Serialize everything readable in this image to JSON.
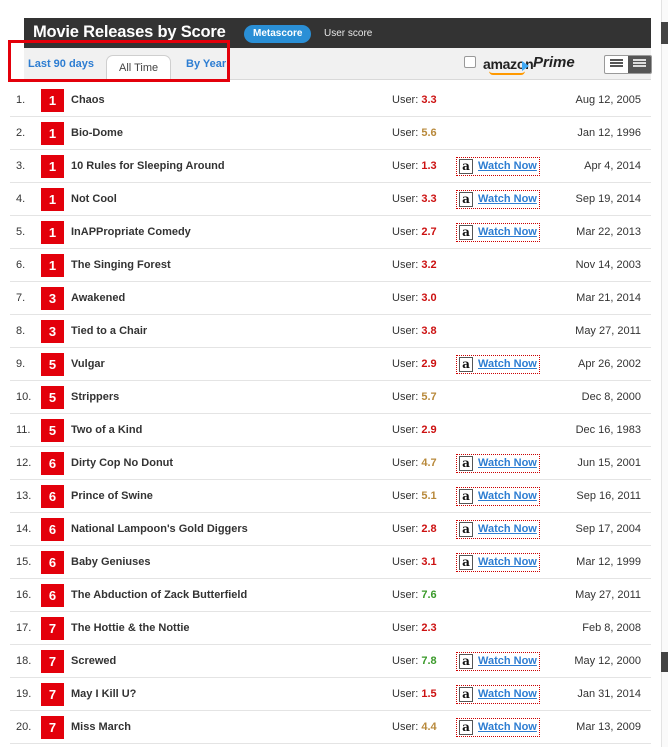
{
  "header": {
    "title": "Movie Releases by Score",
    "metascore_label": "Metascore",
    "userscore_label": "User score"
  },
  "tabs": [
    {
      "label": "Last 90 days"
    },
    {
      "label": "All Time",
      "active": true
    },
    {
      "label": "By Year"
    }
  ],
  "prime": {
    "amazon_word": "amazon",
    "prime_word": "Prime",
    "checked": false
  },
  "user_prefix": "User:",
  "watch_label": "Watch Now",
  "amazon_glyph": "a",
  "colors": {
    "score_bad": "#e3000b",
    "user_red": "#cc1111",
    "user_yellow": "#b8893b",
    "user_green": "#3a9a2a",
    "link_blue": "#2d7dd2",
    "header_bg": "#333333"
  },
  "movies": [
    {
      "rank": "1.",
      "score": "1",
      "title": "Chaos",
      "user": "3.3",
      "color": "red",
      "watch": false,
      "date": "Aug 12, 2005"
    },
    {
      "rank": "2.",
      "score": "1",
      "title": "Bio-Dome",
      "user": "5.6",
      "color": "yellow",
      "watch": false,
      "date": "Jan 12, 1996"
    },
    {
      "rank": "3.",
      "score": "1",
      "title": "10 Rules for Sleeping Around",
      "user": "1.3",
      "color": "red",
      "watch": true,
      "date": "Apr 4, 2014"
    },
    {
      "rank": "4.",
      "score": "1",
      "title": "Not Cool",
      "user": "3.3",
      "color": "red",
      "watch": true,
      "date": "Sep 19, 2014"
    },
    {
      "rank": "5.",
      "score": "1",
      "title": "InAPPropriate Comedy",
      "user": "2.7",
      "color": "red",
      "watch": true,
      "date": "Mar 22, 2013"
    },
    {
      "rank": "6.",
      "score": "1",
      "title": "The Singing Forest",
      "user": "3.2",
      "color": "red",
      "watch": false,
      "date": "Nov 14, 2003"
    },
    {
      "rank": "7.",
      "score": "3",
      "title": "Awakened",
      "user": "3.0",
      "color": "red",
      "watch": false,
      "date": "Mar 21, 2014"
    },
    {
      "rank": "8.",
      "score": "3",
      "title": "Tied to a Chair",
      "user": "3.8",
      "color": "red",
      "watch": false,
      "date": "May 27, 2011"
    },
    {
      "rank": "9.",
      "score": "5",
      "title": "Vulgar",
      "user": "2.9",
      "color": "red",
      "watch": true,
      "date": "Apr 26, 2002"
    },
    {
      "rank": "10.",
      "score": "5",
      "title": "Strippers",
      "user": "5.7",
      "color": "yellow",
      "watch": false,
      "date": "Dec 8, 2000"
    },
    {
      "rank": "11.",
      "score": "5",
      "title": "Two of a Kind",
      "user": "2.9",
      "color": "red",
      "watch": false,
      "date": "Dec 16, 1983"
    },
    {
      "rank": "12.",
      "score": "6",
      "title": "Dirty Cop No Donut",
      "user": "4.7",
      "color": "yellow",
      "watch": true,
      "date": "Jun 15, 2001"
    },
    {
      "rank": "13.",
      "score": "6",
      "title": "Prince of Swine",
      "user": "5.1",
      "color": "yellow",
      "watch": true,
      "date": "Sep 16, 2011"
    },
    {
      "rank": "14.",
      "score": "6",
      "title": "National Lampoon's Gold Diggers",
      "user": "2.8",
      "color": "red",
      "watch": true,
      "date": "Sep 17, 2004"
    },
    {
      "rank": "15.",
      "score": "6",
      "title": "Baby Geniuses",
      "user": "3.1",
      "color": "red",
      "watch": true,
      "date": "Mar 12, 1999"
    },
    {
      "rank": "16.",
      "score": "6",
      "title": "The Abduction of Zack Butterfield",
      "user": "7.6",
      "color": "green",
      "watch": false,
      "date": "May 27, 2011"
    },
    {
      "rank": "17.",
      "score": "7",
      "title": "The Hottie & the Nottie",
      "user": "2.3",
      "color": "red",
      "watch": false,
      "date": "Feb 8, 2008"
    },
    {
      "rank": "18.",
      "score": "7",
      "title": "Screwed",
      "user": "7.8",
      "color": "green",
      "watch": true,
      "date": "May 12, 2000"
    },
    {
      "rank": "19.",
      "score": "7",
      "title": "May I Kill U?",
      "user": "1.5",
      "color": "red",
      "watch": true,
      "date": "Jan 31, 2014"
    },
    {
      "rank": "20.",
      "score": "7",
      "title": "Miss March",
      "user": "4.4",
      "color": "yellow",
      "watch": true,
      "date": "Mar 13, 2009"
    }
  ]
}
